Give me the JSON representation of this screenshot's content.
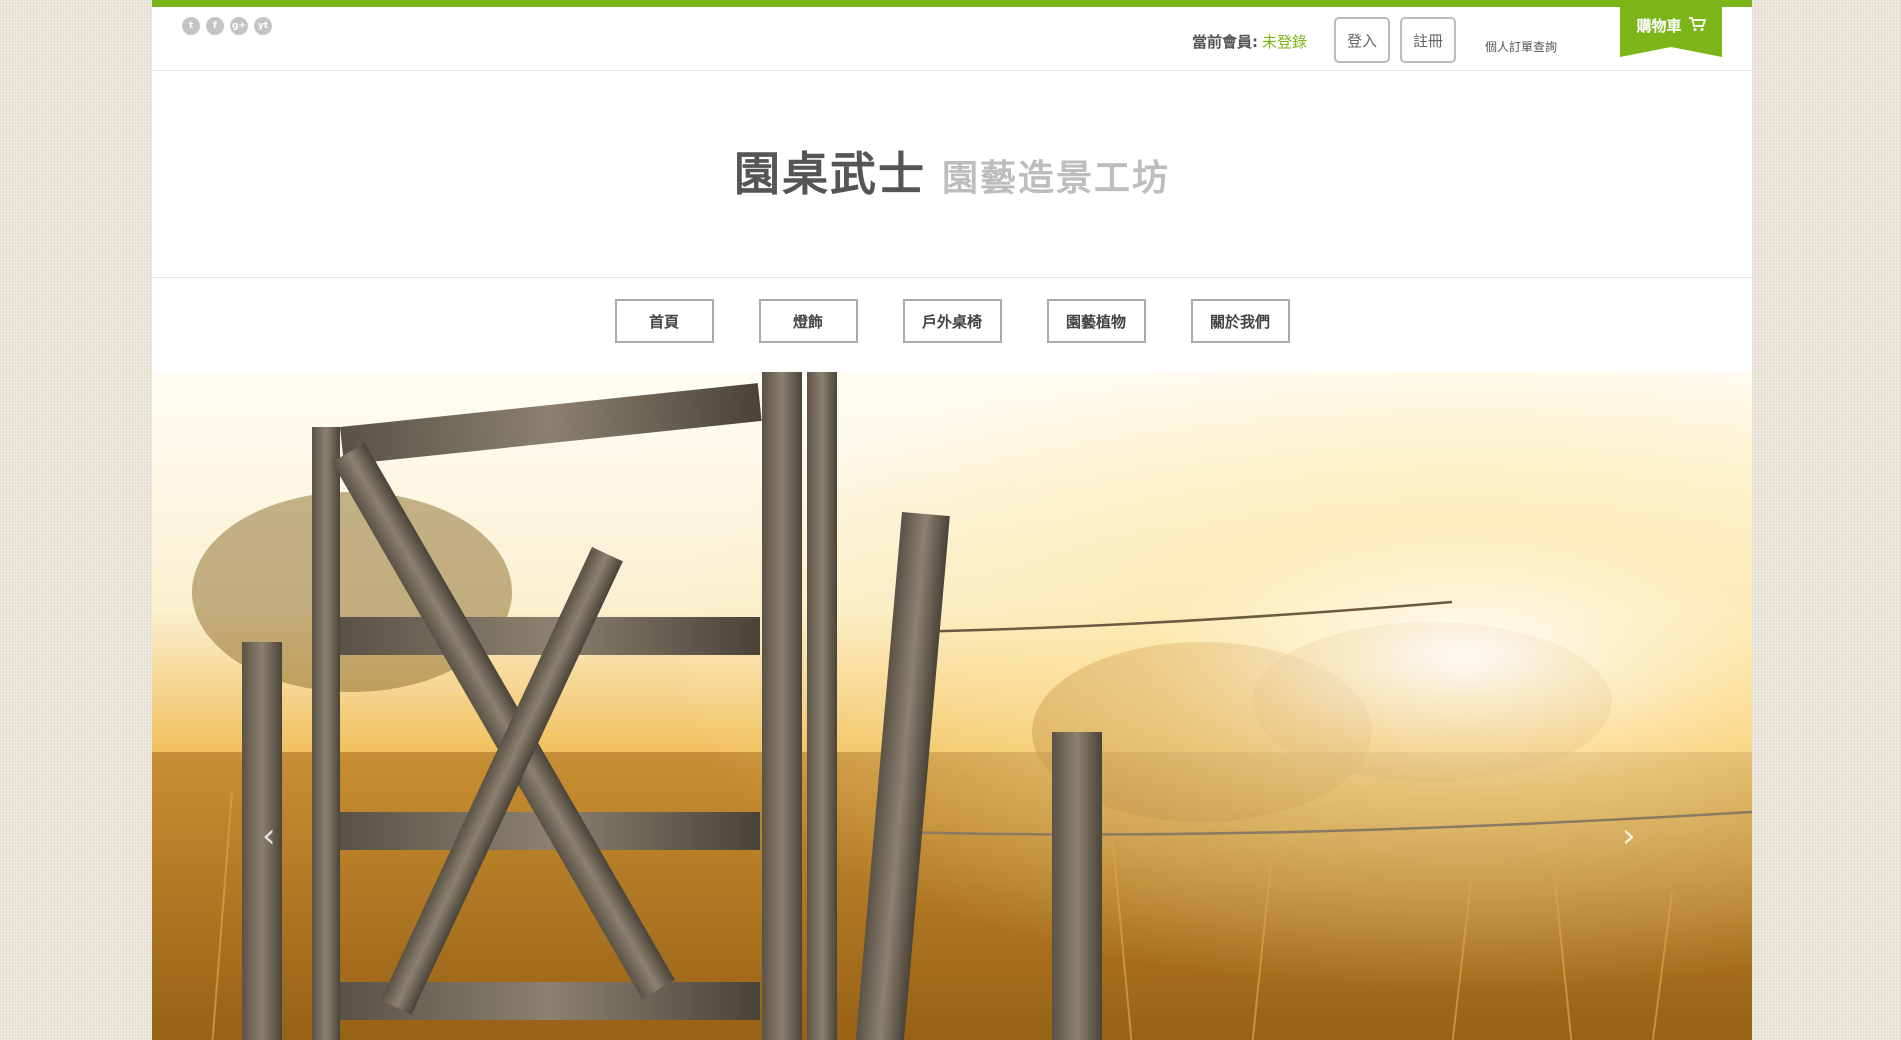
{
  "social_icons": [
    {
      "name": "twitter-icon",
      "glyph": "t"
    },
    {
      "name": "facebook-icon",
      "glyph": "f"
    },
    {
      "name": "google-plus-icon",
      "glyph": "g+"
    },
    {
      "name": "youtube-icon",
      "glyph": "yt"
    }
  ],
  "header": {
    "member_label": "當前會員:",
    "member_status": "未登錄",
    "login_label": "登入",
    "register_label": "註冊",
    "order_query_label": "個人訂單查詢",
    "cart_label": "購物車"
  },
  "logo": {
    "title": "園桌武士",
    "subtitle": "園藝造景工坊"
  },
  "nav": {
    "items": [
      "首頁",
      "燈飾",
      "戶外桌椅",
      "園藝植物",
      "關於我們"
    ]
  },
  "slider": {
    "prev_glyph": "‹",
    "next_glyph": "›"
  },
  "colors": {
    "accent": "#7cb518",
    "background": "#ebe6da"
  }
}
